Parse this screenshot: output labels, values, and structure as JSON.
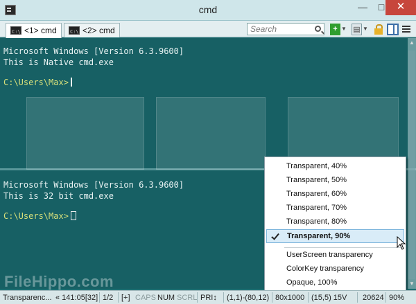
{
  "window": {
    "title": "cmd",
    "min": "—",
    "max": "□",
    "close": "✕"
  },
  "tabs": [
    {
      "label": "<1> cmd",
      "active": true
    },
    {
      "label": "<2> cmd",
      "active": false
    }
  ],
  "toolbar": {
    "search_placeholder": "Search",
    "new_console": "+",
    "dropdown": "▼",
    "console_btn": "▤"
  },
  "console_top": {
    "lines": [
      "Microsoft Windows [Version 6.3.9600]",
      "This is Native cmd.exe"
    ],
    "prompt": "C:\\Users\\Max>"
  },
  "console_bottom": {
    "lines": [
      "Microsoft Windows [Version 6.3.9600]",
      "This is 32 bit cmd.exe"
    ],
    "prompt": "C:\\Users\\Max>"
  },
  "menu": {
    "items": [
      "Transparent, 40%",
      "Transparent, 50%",
      "Transparent, 60%",
      "Transparent, 70%",
      "Transparent, 80%",
      "Transparent, 90%",
      "UserScreen transparency",
      "ColorKey transparency",
      "Opaque, 100%"
    ],
    "checked_index": 5
  },
  "status": {
    "mode": "Transparenc...",
    "pos": "« 141:05[32]",
    "page": "1/2",
    "flag": "[+]",
    "caps": "CAPS",
    "num": "NUM",
    "scrl": "SCRL",
    "pri": "PRI↕",
    "coords": "(1,1)-(80,12)",
    "size": "80x1000",
    "cursor": "(15,5) 15V",
    "pid": "20624",
    "zoom": "90%"
  },
  "watermark": "FileHippo.com",
  "colors": {
    "console_bg": "#1e6f72",
    "prompt": "#d6df7a",
    "close": "#c7463c"
  }
}
